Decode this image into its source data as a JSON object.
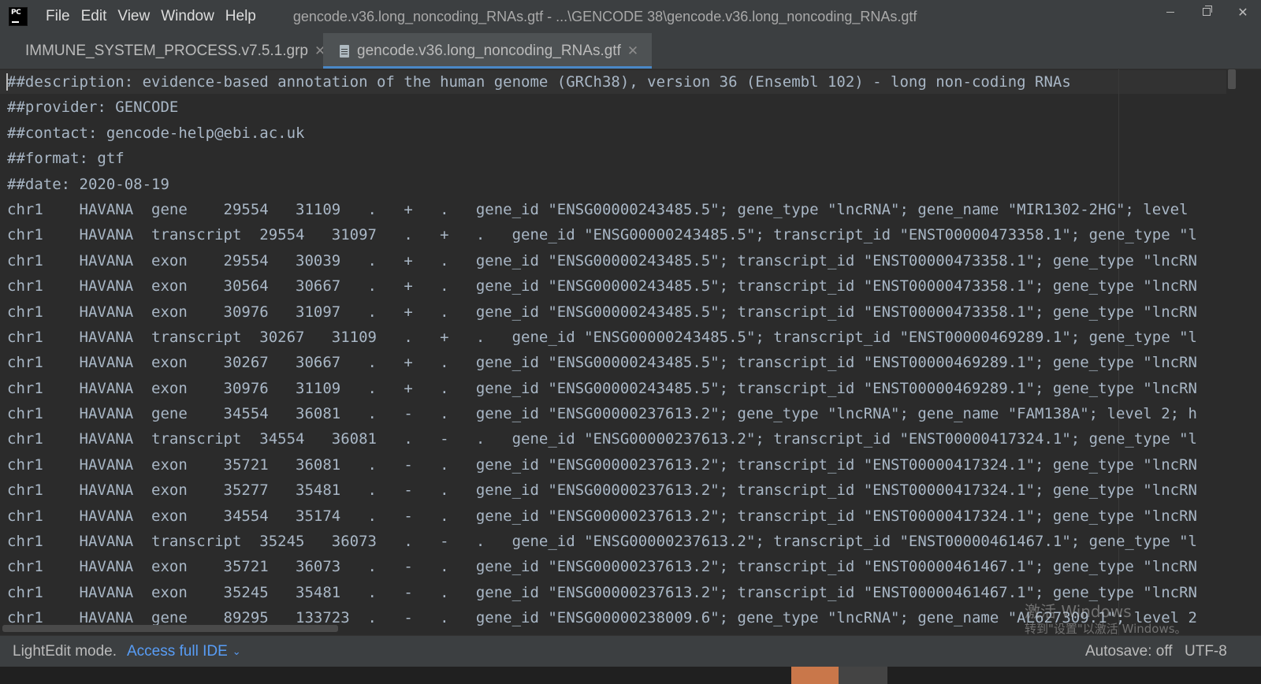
{
  "app": {
    "logo_text": "PC",
    "window_title": "gencode.v36.long_noncoding_RNAs.gtf - ...\\GENCODE 38\\gencode.v36.long_noncoding_RNAs.gtf"
  },
  "menu": [
    "File",
    "Edit",
    "View",
    "Window",
    "Help"
  ],
  "tabs": [
    {
      "label": "IMMUNE_SYSTEM_PROCESS.v7.5.1.grp",
      "active": false
    },
    {
      "label": "gencode.v36.long_noncoding_RNAs.gtf",
      "active": true
    }
  ],
  "editor": {
    "lines": [
      "##description: evidence-based annotation of the human genome (GRCh38), version 36 (Ensembl 102) - long non-coding RNAs",
      "##provider: GENCODE",
      "##contact: gencode-help@ebi.ac.uk",
      "##format: gtf",
      "##date: 2020-08-19",
      "chr1    HAVANA  gene    29554   31109   .   +   .   gene_id \"ENSG00000243485.5\"; gene_type \"lncRNA\"; gene_name \"MIR1302-2HG\"; level",
      "chr1    HAVANA  transcript  29554   31097   .   +   .   gene_id \"ENSG00000243485.5\"; transcript_id \"ENST00000473358.1\"; gene_type \"l",
      "chr1    HAVANA  exon    29554   30039   .   +   .   gene_id \"ENSG00000243485.5\"; transcript_id \"ENST00000473358.1\"; gene_type \"lncRN",
      "chr1    HAVANA  exon    30564   30667   .   +   .   gene_id \"ENSG00000243485.5\"; transcript_id \"ENST00000473358.1\"; gene_type \"lncRN",
      "chr1    HAVANA  exon    30976   31097   .   +   .   gene_id \"ENSG00000243485.5\"; transcript_id \"ENST00000473358.1\"; gene_type \"lncRN",
      "chr1    HAVANA  transcript  30267   31109   .   +   .   gene_id \"ENSG00000243485.5\"; transcript_id \"ENST00000469289.1\"; gene_type \"l",
      "chr1    HAVANA  exon    30267   30667   .   +   .   gene_id \"ENSG00000243485.5\"; transcript_id \"ENST00000469289.1\"; gene_type \"lncRN",
      "chr1    HAVANA  exon    30976   31109   .   +   .   gene_id \"ENSG00000243485.5\"; transcript_id \"ENST00000469289.1\"; gene_type \"lncRN",
      "chr1    HAVANA  gene    34554   36081   .   -   .   gene_id \"ENSG00000237613.2\"; gene_type \"lncRNA\"; gene_name \"FAM138A\"; level 2; h",
      "chr1    HAVANA  transcript  34554   36081   .   -   .   gene_id \"ENSG00000237613.2\"; transcript_id \"ENST00000417324.1\"; gene_type \"l",
      "chr1    HAVANA  exon    35721   36081   .   -   .   gene_id \"ENSG00000237613.2\"; transcript_id \"ENST00000417324.1\"; gene_type \"lncRN",
      "chr1    HAVANA  exon    35277   35481   .   -   .   gene_id \"ENSG00000237613.2\"; transcript_id \"ENST00000417324.1\"; gene_type \"lncRN",
      "chr1    HAVANA  exon    34554   35174   .   -   .   gene_id \"ENSG00000237613.2\"; transcript_id \"ENST00000417324.1\"; gene_type \"lncRN",
      "chr1    HAVANA  transcript  35245   36073   .   -   .   gene_id \"ENSG00000237613.2\"; transcript_id \"ENST00000461467.1\"; gene_type \"l",
      "chr1    HAVANA  exon    35721   36073   .   -   .   gene_id \"ENSG00000237613.2\"; transcript_id \"ENST00000461467.1\"; gene_type \"lncRN",
      "chr1    HAVANA  exon    35245   35481   .   -   .   gene_id \"ENSG00000237613.2\"; transcript_id \"ENST00000461467.1\"; gene_type \"lncRN",
      "chr1    HAVANA  gene    89295   133723  .   -   .   gene_id \"ENSG00000238009.6\"; gene_type \"lncRNA\"; gene_name \"AL627309.1\"; level 2"
    ]
  },
  "watermark": {
    "line1": "激活 Windows",
    "line2": "转到\"设置\"以激活 Windows。"
  },
  "status": {
    "mode": "LightEdit mode.",
    "link": "Access full IDE",
    "autosave": "Autosave: off",
    "encoding": "UTF-8"
  },
  "icons": {
    "file": "file-icon",
    "close": "close-icon",
    "chevron": "chevron-down-icon"
  }
}
